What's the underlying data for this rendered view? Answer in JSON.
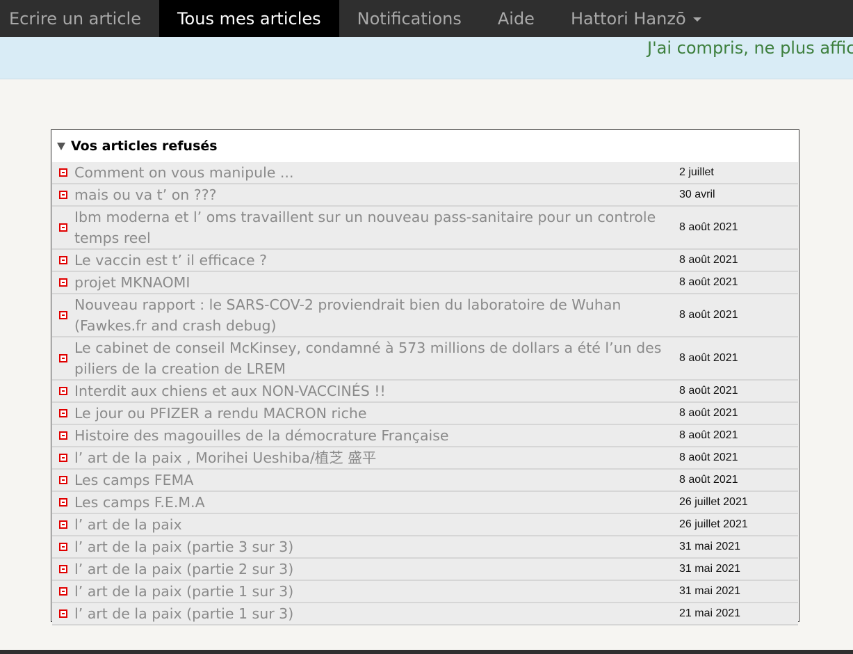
{
  "nav": {
    "items": [
      {
        "label": "Ecrire un article"
      },
      {
        "label": "Tous mes articles"
      },
      {
        "label": "Notifications"
      },
      {
        "label": "Aide"
      },
      {
        "label": "Hattori Hanzō"
      }
    ],
    "active_index": 1
  },
  "banner": {
    "dismiss_label": "J'ai compris, ne plus affic"
  },
  "rejected": {
    "heading": "Vos articles refusés",
    "icon": "rejected-status-icon",
    "status_color": "#e00000",
    "articles": [
      {
        "title": "Comment on vous manipule ...",
        "date": "2 juillet"
      },
      {
        "title": "mais ou va t’ on ???",
        "date": "30 avril"
      },
      {
        "title": "Ibm moderna et l’ oms travaillent sur un nouveau pass-sanitaire pour un controle temps reel",
        "date": "8 août 2021"
      },
      {
        "title": "Le vaccin est t’ il efficace ?",
        "date": "8 août 2021"
      },
      {
        "title": "projet MKNAOMI",
        "date": "8 août 2021"
      },
      {
        "title": "Nouveau rapport : le SARS-COV-2 proviendrait bien du laboratoire de Wuhan (Fawkes.fr and crash debug)",
        "date": "8 août 2021"
      },
      {
        "title": "Le cabinet de conseil McKinsey, condamné à 573 millions de dollars a été l’un des piliers de la creation de LREM",
        "date": "8 août 2021"
      },
      {
        "title": "Interdit aux chiens et aux NON-VACCINÉS !!",
        "date": "8 août 2021"
      },
      {
        "title": "Le jour ou PFIZER a rendu MACRON riche",
        "date": "8 août 2021"
      },
      {
        "title": "Histoire des magouilles de la démocrature Française",
        "date": "8 août 2021"
      },
      {
        "title": "l’ art de la paix , Morihei Ueshiba/植芝 盛平",
        "date": "8 août 2021"
      },
      {
        "title": "Les camps FEMA",
        "date": "8 août 2021"
      },
      {
        "title": "Les camps F.E.M.A",
        "date": "26 juillet 2021"
      },
      {
        "title": "l’ art de la paix",
        "date": "26 juillet 2021"
      },
      {
        "title": "l’ art de la paix (partie 3 sur 3)",
        "date": "31 mai 2021"
      },
      {
        "title": "l’ art de la paix (partie 2 sur 3)",
        "date": "31 mai 2021"
      },
      {
        "title": "l’ art de la paix (partie 1 sur 3)",
        "date": "31 mai 2021"
      },
      {
        "title": "l’ art de la paix (partie 1 sur 3)",
        "date": "21 mai 2021"
      }
    ]
  }
}
